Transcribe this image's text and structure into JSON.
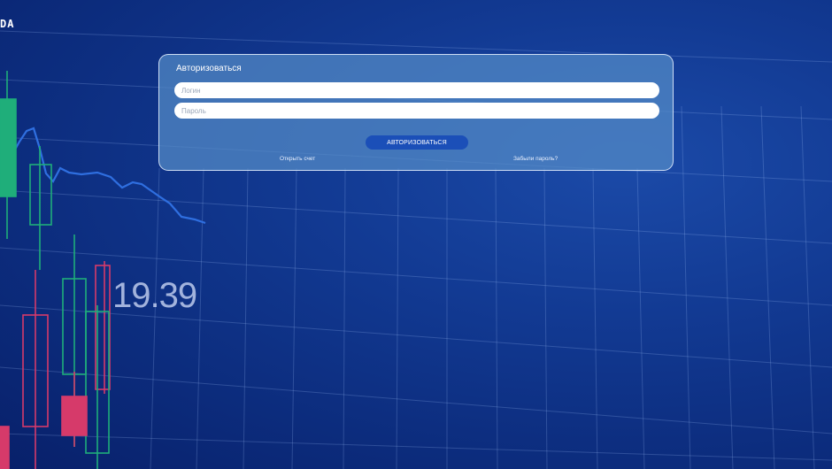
{
  "logo_text": "DA",
  "price_value": "19.39",
  "form": {
    "title": "Авторизоваться",
    "login_placeholder": "Логин",
    "password_placeholder": "Пароль",
    "submit_label": "АВТОРИЗОВАТЬСЯ",
    "open_account_label": "Открыть счет",
    "forgot_password_label": "Забыли пароль?"
  },
  "colors": {
    "background": "#0c2c7d",
    "card": "#548cc8",
    "button": "#1b4fb8",
    "candle_green": "#1fae7a",
    "candle_red": "#d63a6a",
    "trend_line": "#2f6fe0"
  }
}
